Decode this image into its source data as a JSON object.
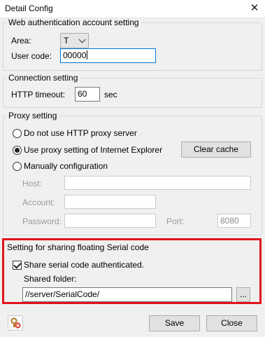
{
  "window": {
    "title": "Detail Config",
    "close_glyph": "✕"
  },
  "web_auth": {
    "legend": "Web authentication account setting",
    "area_label": "Area:",
    "area_value": "T",
    "user_code_label": "User code:",
    "user_code_value": "00000"
  },
  "connection": {
    "legend": "Connection setting",
    "timeout_label": "HTTP timeout:",
    "timeout_value": "60",
    "timeout_unit": "sec"
  },
  "proxy": {
    "legend": "Proxy setting",
    "options": [
      {
        "label": "Do not use HTTP proxy server",
        "selected": false
      },
      {
        "label": "Use proxy setting of Internet Explorer",
        "selected": true
      },
      {
        "label": "Manually configuration",
        "selected": false
      }
    ],
    "clear_cache_label": "Clear cache",
    "host_label": "Host:",
    "host_value": "",
    "account_label": "Account:",
    "account_value": "",
    "password_label": "Password:",
    "password_value": "",
    "port_label": "Port:",
    "port_value": "8080"
  },
  "serial_share": {
    "legend": "Setting for sharing floating Serial code",
    "share_checkbox_label": "Share serial code authenticated.",
    "share_checked": true,
    "folder_label": "Shared folder:",
    "folder_value": "//server/SerialCode/",
    "browse_label": "..."
  },
  "footer": {
    "save_label": "Save",
    "close_label": "Close",
    "icon": "key-lock-icon"
  },
  "colors": {
    "highlight": "#e0141c",
    "focus_border": "#0078d7"
  }
}
